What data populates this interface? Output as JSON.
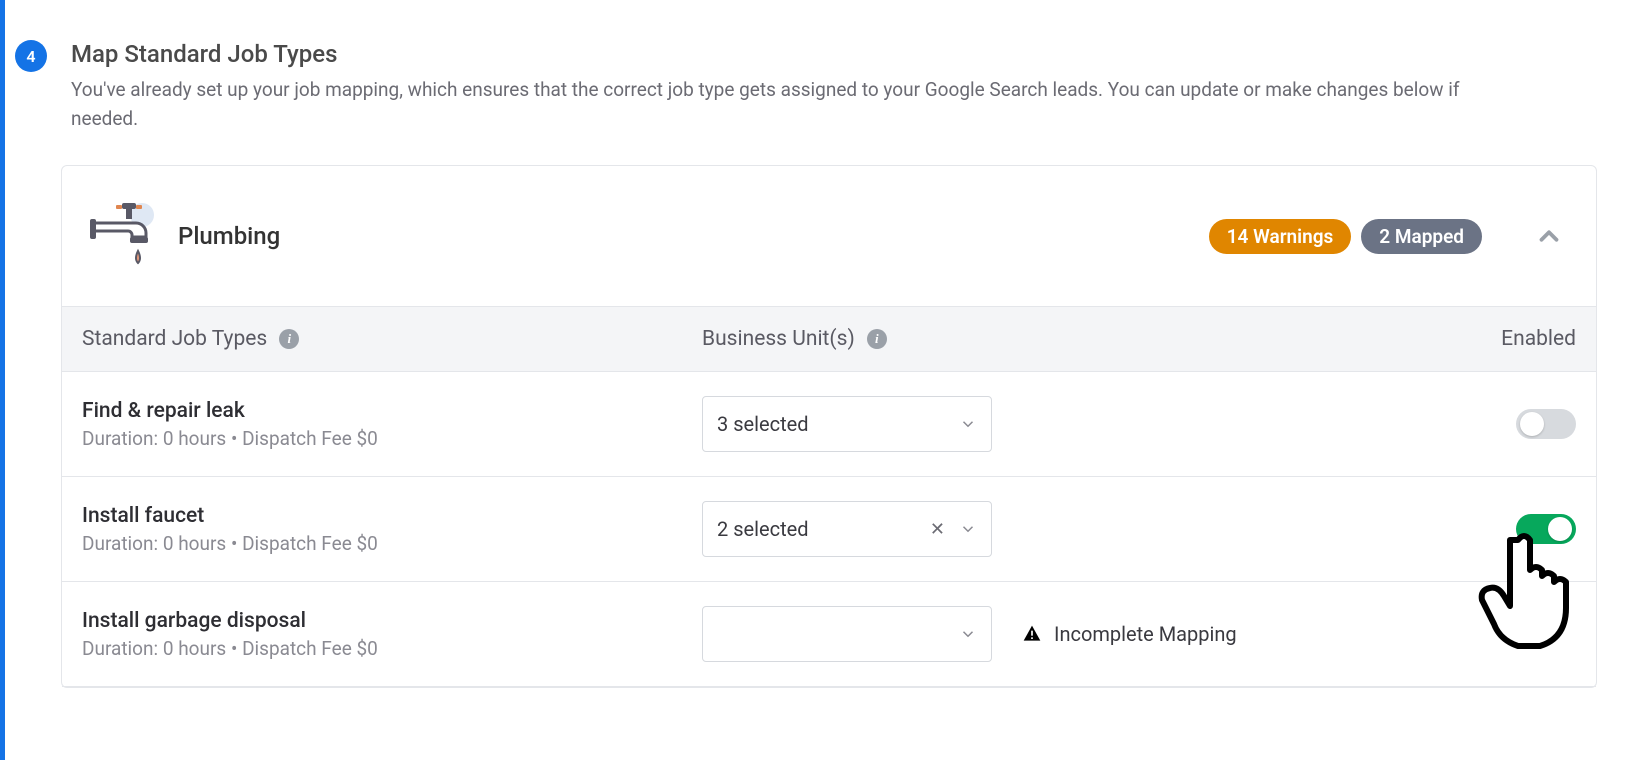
{
  "step": {
    "number": "4",
    "title": "Map Standard Job Types",
    "subtitle": "You've already set up your job mapping, which ensures that the correct job type gets assigned to your Google Search leads. You can update or make changes below if needed."
  },
  "category": {
    "name": "Plumbing",
    "warnings_label": "14 Warnings",
    "mapped_label": "2 Mapped"
  },
  "table": {
    "col_job": "Standard Job Types",
    "col_bu": "Business Unit(s)",
    "col_enabled": "Enabled"
  },
  "rows": [
    {
      "name": "Find & repair leak",
      "meta": "Duration: 0 hours • Dispatch Fee $0",
      "select": "3 selected",
      "clearable": false,
      "enabled": false,
      "warning": ""
    },
    {
      "name": "Install faucet",
      "meta": "Duration: 0 hours • Dispatch Fee $0",
      "select": "2 selected",
      "clearable": true,
      "enabled": true,
      "warning": ""
    },
    {
      "name": "Install garbage disposal",
      "meta": "Duration: 0 hours • Dispatch Fee $0",
      "select": "",
      "clearable": false,
      "enabled": null,
      "warning": "Incomplete Mapping"
    }
  ],
  "icons": {
    "info": "i"
  }
}
